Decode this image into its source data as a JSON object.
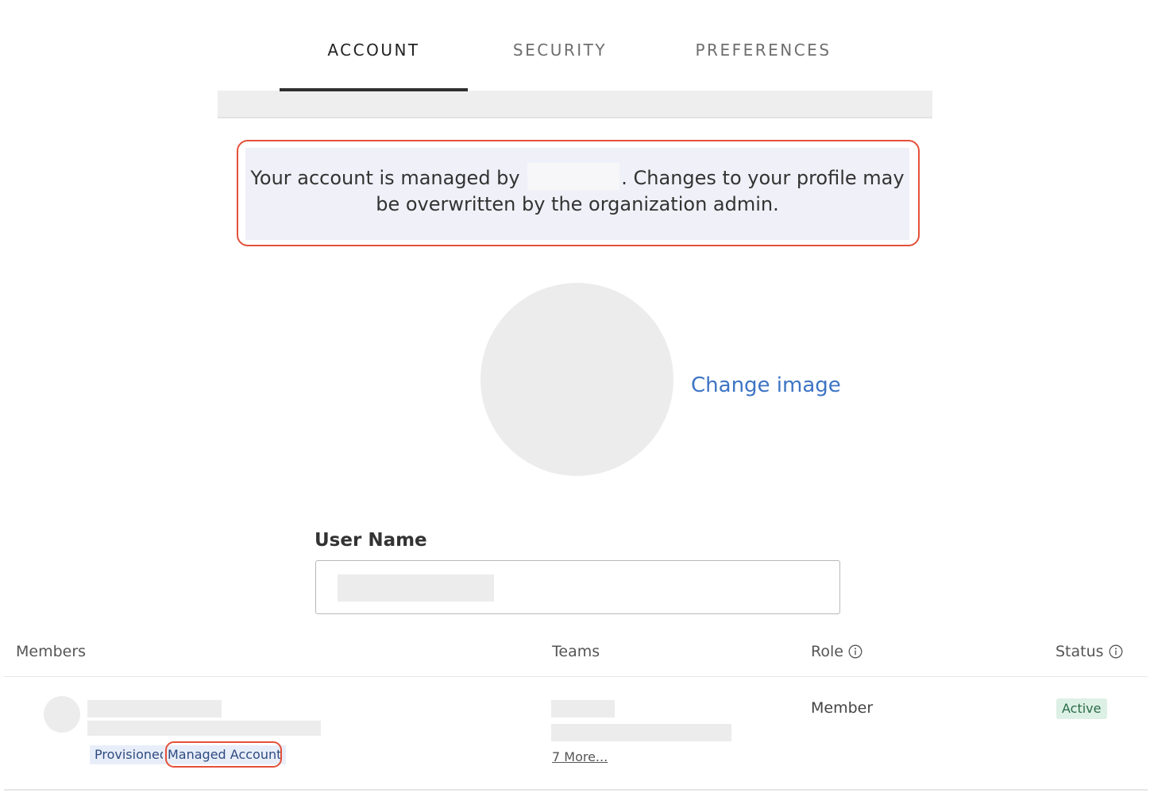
{
  "tabs": [
    {
      "label": "ACCOUNT",
      "active": true
    },
    {
      "label": "SECURITY",
      "active": false
    },
    {
      "label": "PREFERENCES",
      "active": false
    }
  ],
  "notice": {
    "line1_before": "Your account is managed by",
    "line1_after": ". Changes to your profile may",
    "line2": "be overwritten by the organization admin."
  },
  "profile": {
    "change_image_label": "Change image",
    "username_label": "User Name"
  },
  "members_table": {
    "headers": {
      "members": "Members",
      "teams": "Teams",
      "role": "Role",
      "status": "Status"
    },
    "rows": [
      {
        "badges": [
          "Provisioned",
          "Managed Account"
        ],
        "teams_more": "7 More...",
        "role": "Member",
        "status": "Active"
      }
    ]
  },
  "colors": {
    "accent_link": "#3d74c4",
    "highlight_outline": "#e5503a",
    "status_active_bg": "#ddf0e5",
    "status_active_text": "#2a6b47"
  },
  "icons": {
    "role_info": "info-circle-icon",
    "status_info": "info-circle-icon"
  }
}
